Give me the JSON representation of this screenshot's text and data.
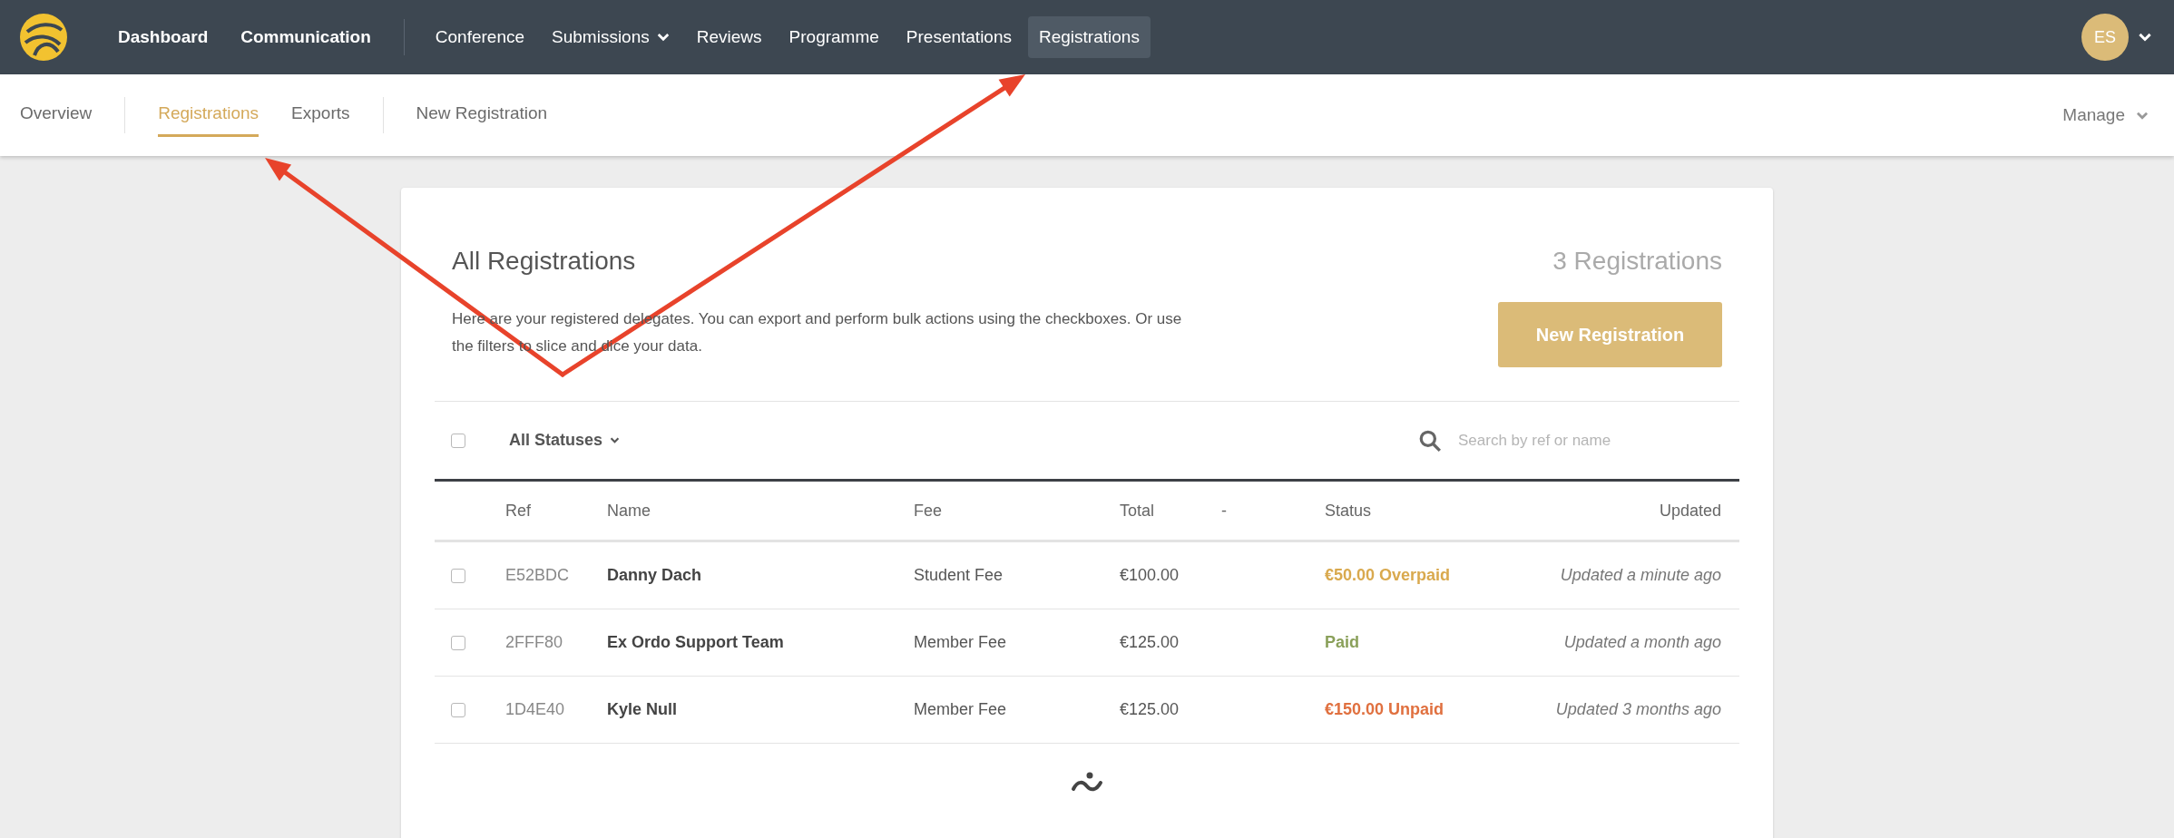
{
  "top_nav": {
    "primary": [
      {
        "label": "Dashboard",
        "selected": false
      },
      {
        "label": "Communication",
        "selected": false
      }
    ],
    "items": [
      {
        "label": "Conference",
        "selected": false,
        "has_menu": false
      },
      {
        "label": "Submissions",
        "selected": false,
        "has_menu": true
      },
      {
        "label": "Reviews",
        "selected": false,
        "has_menu": false
      },
      {
        "label": "Programme",
        "selected": false,
        "has_menu": false
      },
      {
        "label": "Presentations",
        "selected": false,
        "has_menu": false
      },
      {
        "label": "Registrations",
        "selected": true,
        "has_menu": false
      }
    ],
    "avatar": "ES"
  },
  "sub_nav": {
    "groups": [
      [
        {
          "label": "Overview",
          "selected": false
        }
      ],
      [
        {
          "label": "Registrations",
          "selected": true
        },
        {
          "label": "Exports",
          "selected": false
        }
      ],
      [
        {
          "label": "New Registration",
          "selected": false
        }
      ]
    ],
    "manage": "Manage"
  },
  "card": {
    "title": "All Registrations",
    "count": "3 Registrations",
    "description": "Here are your registered delegates. You can export and perform bulk actions using the checkboxes. Or use the filters to slice and dice your data.",
    "button": "New Registration",
    "filter": {
      "select_all_checked": false,
      "status": "All Statuses",
      "search_placeholder": "Search by ref or name"
    },
    "table": {
      "columns": [
        "Ref",
        "Name",
        "Fee",
        "Total",
        "-",
        "Status",
        "Updated"
      ],
      "rows": [
        {
          "checked": false,
          "ref": "E52BDC",
          "name": "Danny Dach",
          "fee": "Student Fee",
          "total": "€100.00",
          "status": "€50.00 Overpaid",
          "color": "#d9a94e",
          "updated": "Updated a minute ago"
        },
        {
          "checked": false,
          "ref": "2FFF80",
          "name": "Ex Ordo Support Team",
          "fee": "Member Fee",
          "total": "€125.00",
          "status": "Paid",
          "color": "#8aa05a",
          "updated": "Updated a month ago"
        },
        {
          "checked": false,
          "ref": "1D4E40",
          "name": "Kyle Null",
          "fee": "Member Fee",
          "total": "€125.00",
          "status": "€150.00 Unpaid",
          "color": "#e0703f",
          "updated": "Updated 3 months ago"
        }
      ]
    }
  }
}
